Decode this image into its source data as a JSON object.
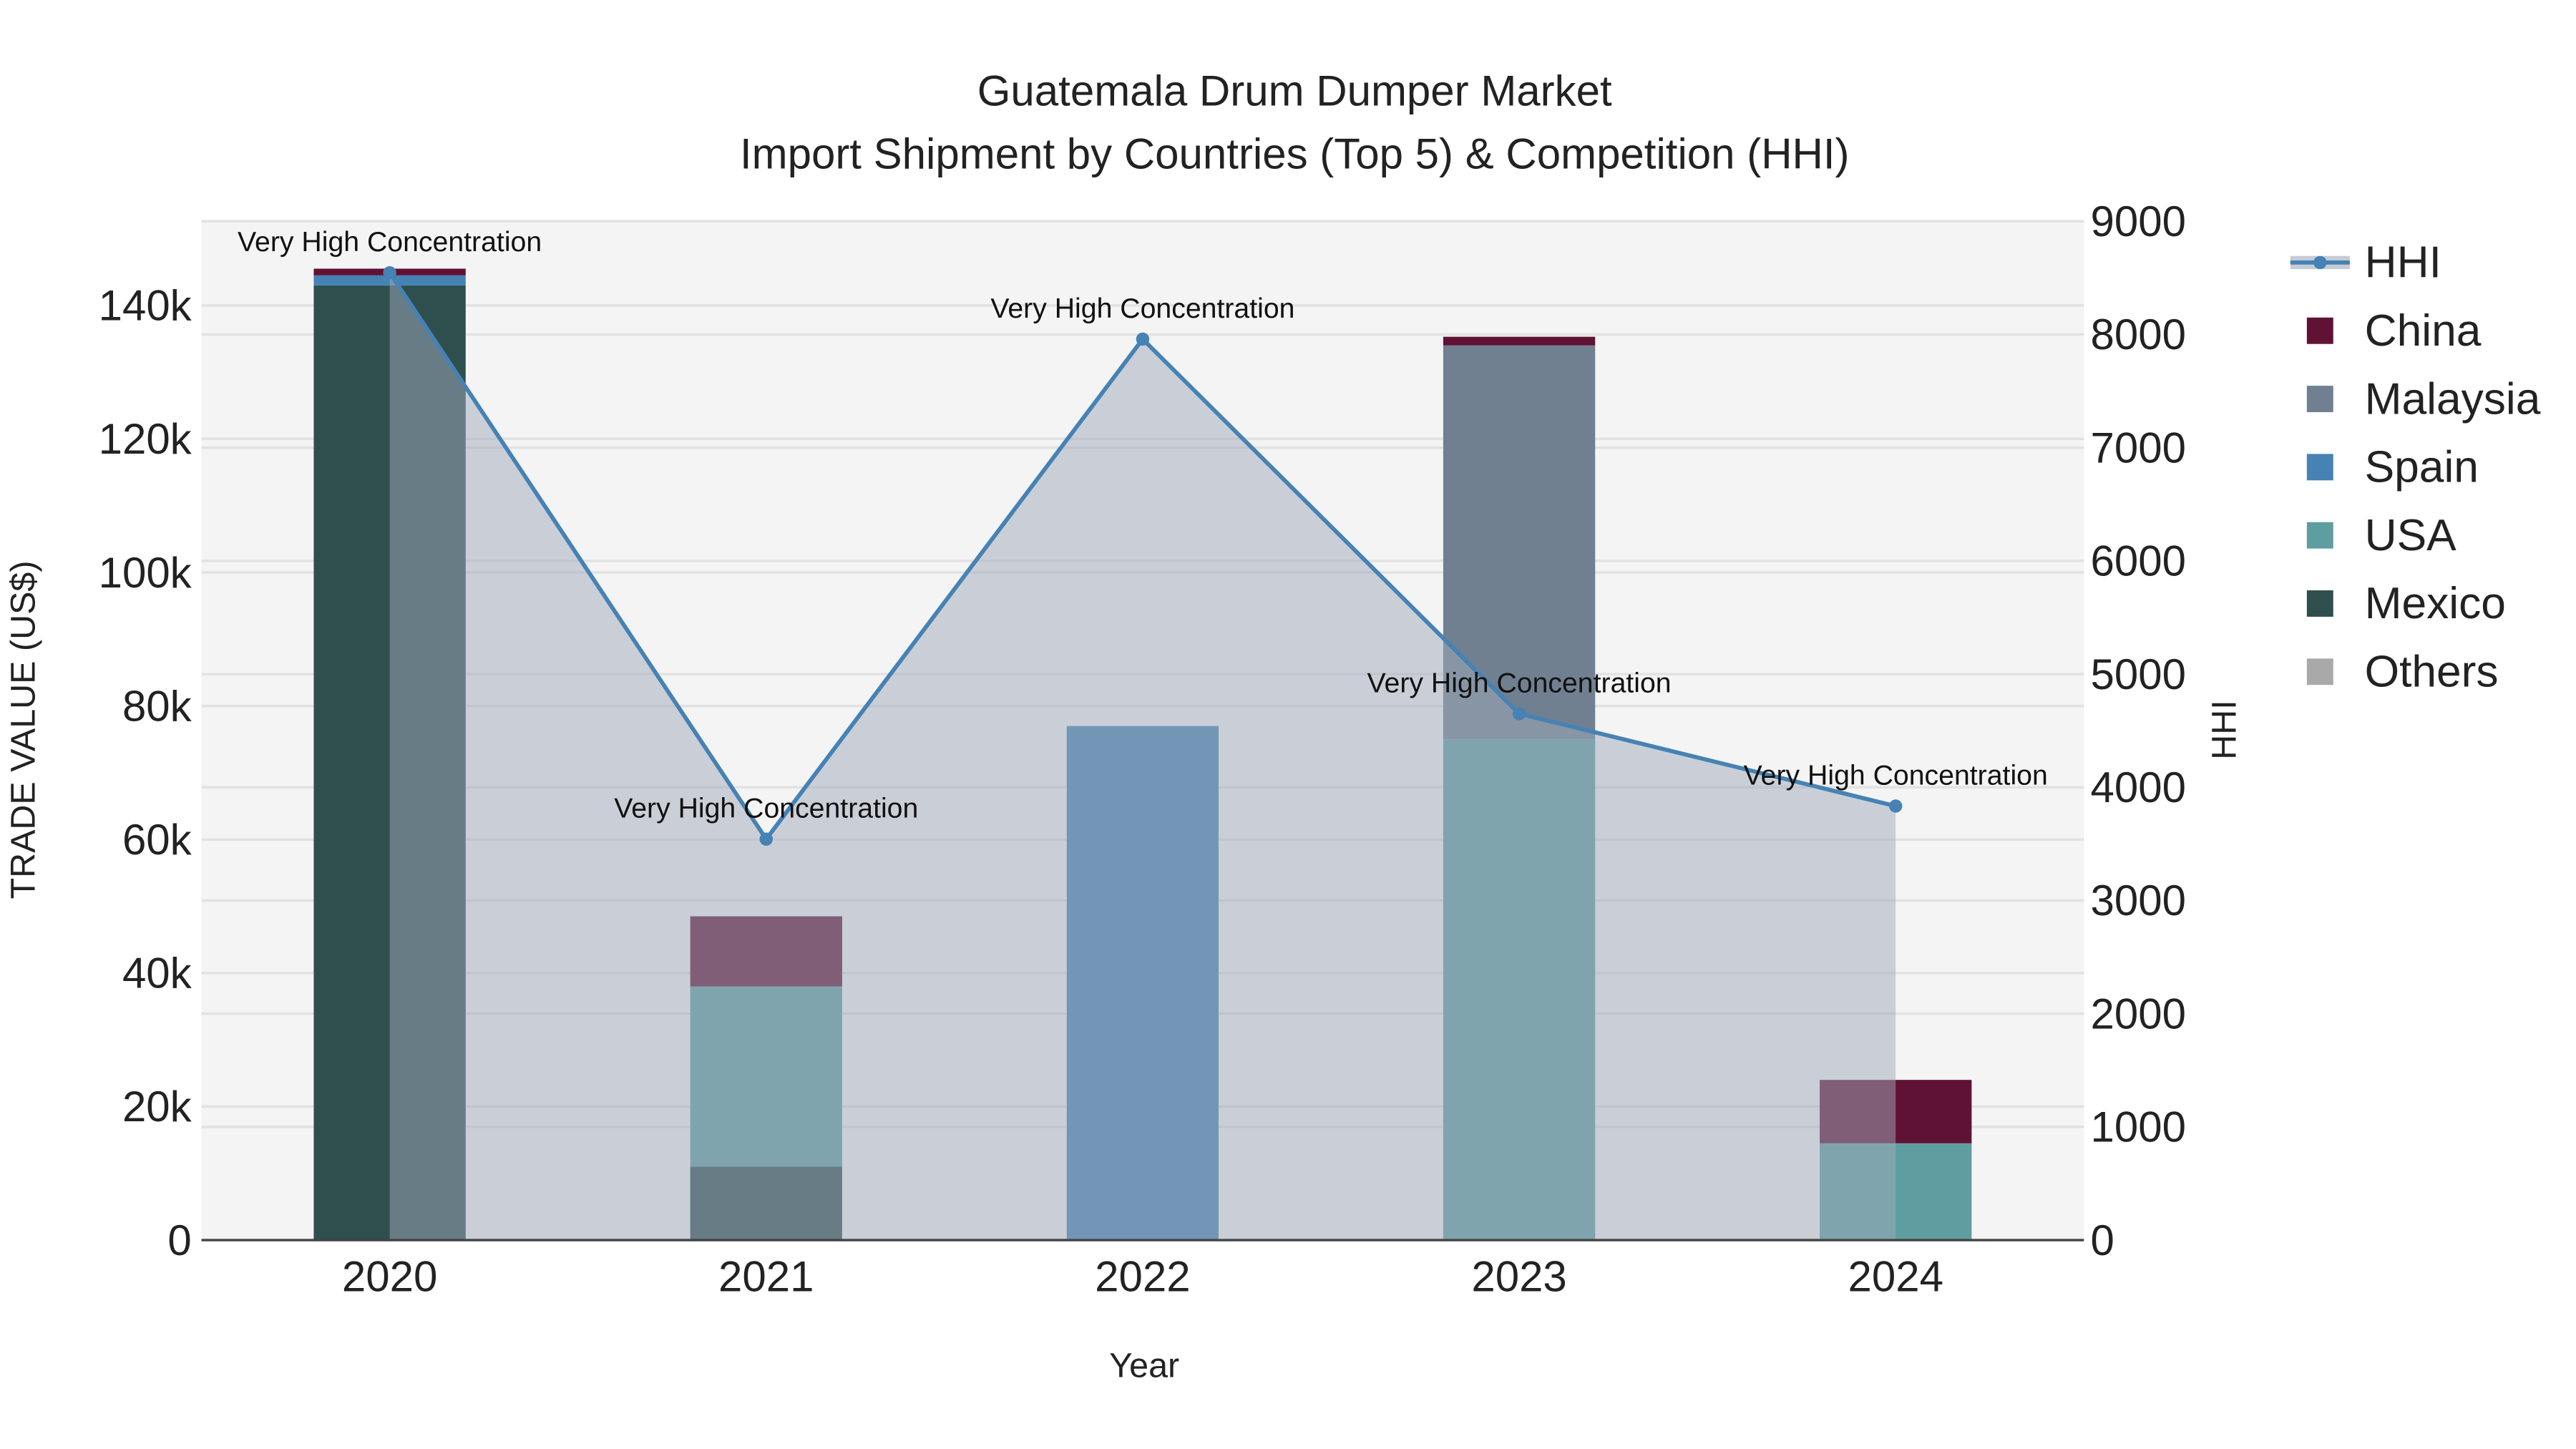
{
  "chart_data": {
    "type": "bar",
    "title": "Guatemala Drum Dumper Market",
    "subtitle": "Import Shipment by Countries (Top 5) & Competition (HHI)",
    "xlabel": "Year",
    "ylabel": "TRADE VALUE (US$)",
    "y2label": "HHI",
    "categories": [
      "2020",
      "2021",
      "2022",
      "2023",
      "2024"
    ],
    "ylim": [
      0,
      152600
    ],
    "y2lim": [
      0,
      9000
    ],
    "yticks": [
      0,
      20000,
      40000,
      60000,
      80000,
      100000,
      120000,
      140000
    ],
    "ytick_labels": [
      "0",
      "20k",
      "40k",
      "60k",
      "80k",
      "100k",
      "120k",
      "140k"
    ],
    "y2ticks": [
      0,
      1000,
      2000,
      3000,
      4000,
      5000,
      6000,
      7000,
      8000,
      9000
    ],
    "y2tick_labels": [
      "0",
      "1000",
      "2000",
      "3000",
      "4000",
      "5000",
      "6000",
      "7000",
      "8000",
      "9000"
    ],
    "grid": true,
    "legend_position": "right",
    "series": [
      {
        "name": "Mexico",
        "color": "#2f4f4f",
        "values": [
          143000,
          11000,
          0,
          0,
          0
        ]
      },
      {
        "name": "USA",
        "color": "#5f9ea0",
        "values": [
          0,
          27000,
          0,
          75000,
          14500
        ]
      },
      {
        "name": "Spain",
        "color": "#4682b4",
        "values": [
          1500,
          0,
          77000,
          0,
          0
        ]
      },
      {
        "name": "Malaysia",
        "color": "#708090",
        "values": [
          0,
          0,
          0,
          59000,
          0
        ]
      },
      {
        "name": "China",
        "color": "#601235",
        "values": [
          1000,
          10500,
          0,
          1300,
          9500
        ]
      },
      {
        "name": "Others",
        "color": "#a9a9a9",
        "values": [
          0,
          0,
          0,
          0,
          0
        ]
      }
    ],
    "hhi": {
      "name": "HHI",
      "color": "#4682b4",
      "values": [
        8545,
        3542,
        7959,
        4650,
        3834
      ],
      "annotations": [
        "Very High Concentration",
        "Very High Concentration",
        "Very High Concentration",
        "Very High Concentration",
        "Very High Concentration"
      ]
    },
    "legend": [
      "HHI",
      "China",
      "Malaysia",
      "Spain",
      "USA",
      "Mexico",
      "Others"
    ]
  }
}
